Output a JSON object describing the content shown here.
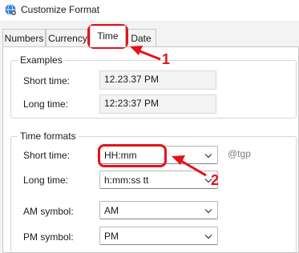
{
  "window": {
    "title": "Customize Format"
  },
  "tabs": [
    {
      "label": "Numbers"
    },
    {
      "label": "Currency"
    },
    {
      "label": "Time"
    },
    {
      "label": "Date"
    }
  ],
  "examples": {
    "group_label": "Examples",
    "short_time_label": "Short time:",
    "short_time_value": "12.23.37 PM",
    "long_time_label": "Long time:",
    "long_time_value": "12:23:37 PM"
  },
  "formats": {
    "group_label": "Time formats",
    "short_time_label": "Short time:",
    "short_time_value": "HH:mm",
    "long_time_label": "Long time:",
    "long_time_value": "h:mm:ss tt",
    "am_label": "AM symbol:",
    "am_value": "AM",
    "pm_label": "PM symbol:",
    "pm_value": "PM"
  },
  "annotations": {
    "marker_1": "1",
    "marker_2": "2",
    "watermark": "@tgp",
    "color": "#e5121c"
  },
  "icons": {
    "window": "globe-settings-icon",
    "dropdown": "chevron-down-icon"
  }
}
